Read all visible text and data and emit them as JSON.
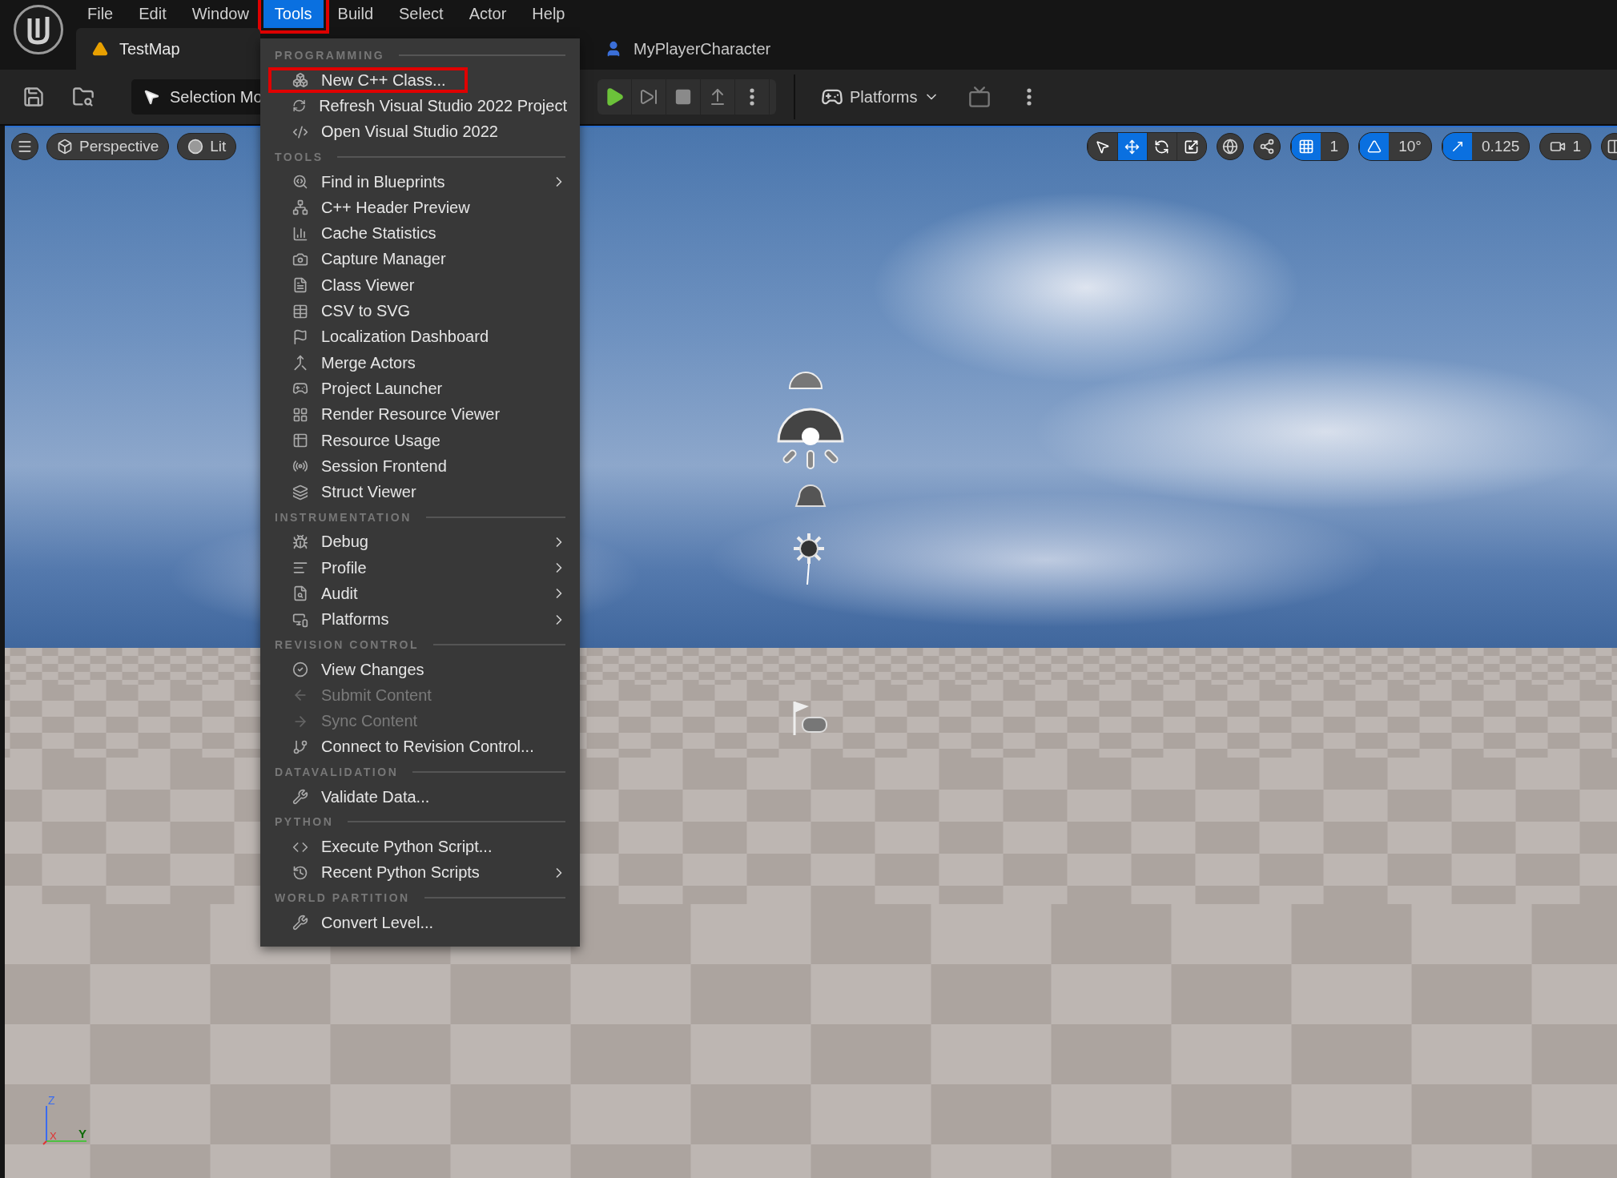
{
  "menubar": {
    "items": [
      {
        "label": "File",
        "selected": false,
        "annotated": false
      },
      {
        "label": "Edit",
        "selected": false,
        "annotated": false
      },
      {
        "label": "Window",
        "selected": false,
        "annotated": false
      },
      {
        "label": "Tools",
        "selected": true,
        "annotated": true
      },
      {
        "label": "Build",
        "selected": false,
        "annotated": false
      },
      {
        "label": "Select",
        "selected": false,
        "annotated": false
      },
      {
        "label": "Actor",
        "selected": false,
        "annotated": false
      },
      {
        "label": "Help",
        "selected": false,
        "annotated": false
      }
    ]
  },
  "tabs": [
    {
      "label": "TestMap",
      "kind": "level",
      "selected": true
    },
    {
      "label": "MyPlayerCharacter",
      "kind": "blueprint",
      "selected": false
    }
  ],
  "toolbar": {
    "selection_mode": "Selection Mo",
    "platforms": "Platforms"
  },
  "viewport": {
    "view_buttons": [
      "Perspective",
      "Lit"
    ],
    "transform_tools": [
      {
        "selected": false
      },
      {
        "selected": true
      },
      {
        "selected": false
      },
      {
        "selected": false
      }
    ],
    "snaps": [
      {
        "kind": "grid",
        "value": "1",
        "on": true
      },
      {
        "kind": "angle",
        "value": "10°",
        "on": true
      },
      {
        "kind": "scale",
        "value": "0.125",
        "on": true
      }
    ],
    "camera_speed": "1",
    "axes": {
      "z": "Z",
      "x": "X",
      "y": "Y"
    }
  },
  "menu": {
    "sections": [
      {
        "header": "PROGRAMMING",
        "items": [
          {
            "label": "New C++ Class...",
            "disabled": false,
            "submenu": false,
            "annotated": true
          },
          {
            "label": "Refresh Visual Studio 2022 Project",
            "disabled": false,
            "submenu": false,
            "annotated": false
          },
          {
            "label": "Open Visual Studio 2022",
            "disabled": false,
            "submenu": false,
            "annotated": false
          }
        ]
      },
      {
        "header": "TOOLS",
        "items": [
          {
            "label": "Find in Blueprints",
            "disabled": false,
            "submenu": true,
            "annotated": false
          },
          {
            "label": "C++ Header Preview",
            "disabled": false,
            "submenu": false,
            "annotated": false
          },
          {
            "label": "Cache Statistics",
            "disabled": false,
            "submenu": false,
            "annotated": false
          },
          {
            "label": "Capture Manager",
            "disabled": false,
            "submenu": false,
            "annotated": false
          },
          {
            "label": "Class Viewer",
            "disabled": false,
            "submenu": false,
            "annotated": false
          },
          {
            "label": "CSV to SVG",
            "disabled": false,
            "submenu": false,
            "annotated": false
          },
          {
            "label": "Localization Dashboard",
            "disabled": false,
            "submenu": false,
            "annotated": false
          },
          {
            "label": "Merge Actors",
            "disabled": false,
            "submenu": false,
            "annotated": false
          },
          {
            "label": "Project Launcher",
            "disabled": false,
            "submenu": false,
            "annotated": false
          },
          {
            "label": "Render Resource Viewer",
            "disabled": false,
            "submenu": false,
            "annotated": false
          },
          {
            "label": "Resource Usage",
            "disabled": false,
            "submenu": false,
            "annotated": false
          },
          {
            "label": "Session Frontend",
            "disabled": false,
            "submenu": false,
            "annotated": false
          },
          {
            "label": "Struct Viewer",
            "disabled": false,
            "submenu": false,
            "annotated": false
          }
        ]
      },
      {
        "header": "INSTRUMENTATION",
        "items": [
          {
            "label": "Debug",
            "disabled": false,
            "submenu": true,
            "annotated": false
          },
          {
            "label": "Profile",
            "disabled": false,
            "submenu": true,
            "annotated": false
          },
          {
            "label": "Audit",
            "disabled": false,
            "submenu": true,
            "annotated": false
          },
          {
            "label": "Platforms",
            "disabled": false,
            "submenu": true,
            "annotated": false
          }
        ]
      },
      {
        "header": "REVISION CONTROL",
        "items": [
          {
            "label": "View Changes",
            "disabled": false,
            "submenu": false,
            "annotated": false
          },
          {
            "label": "Submit Content",
            "disabled": true,
            "submenu": false,
            "annotated": false
          },
          {
            "label": "Sync Content",
            "disabled": true,
            "submenu": false,
            "annotated": false
          },
          {
            "label": "Connect to Revision Control...",
            "disabled": false,
            "submenu": false,
            "annotated": false
          }
        ]
      },
      {
        "header": "DATAVALIDATION",
        "items": [
          {
            "label": "Validate Data...",
            "disabled": false,
            "submenu": false,
            "annotated": false
          }
        ]
      },
      {
        "header": "PYTHON",
        "items": [
          {
            "label": "Execute Python Script...",
            "disabled": false,
            "submenu": false,
            "annotated": false
          },
          {
            "label": "Recent Python Scripts",
            "disabled": false,
            "submenu": true,
            "annotated": false
          }
        ]
      },
      {
        "header": "WORLD PARTITION",
        "items": [
          {
            "label": "Convert Level...",
            "disabled": false,
            "submenu": false,
            "annotated": false
          }
        ]
      }
    ]
  }
}
